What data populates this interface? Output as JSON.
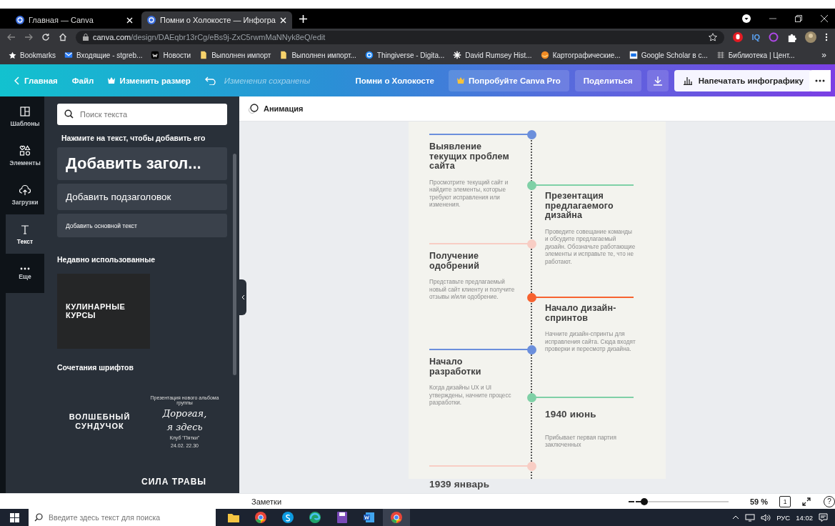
{
  "browser": {
    "tabs": [
      {
        "title": "Главная — Canva",
        "selected": false
      },
      {
        "title": "Помни о Холокосте — Инфогра",
        "selected": true
      }
    ],
    "url_host": "canva.com",
    "url_path": "/design/DAEqbr13rCg/eBs9j-ZxC5rwmMaNNyk8eQ/edit",
    "extension_label": "IQ",
    "bookmarks": [
      {
        "label": "Bookmarks",
        "kind": "star"
      },
      {
        "label": "Входящие - stgreb...",
        "kind": "mail"
      },
      {
        "label": "Новости",
        "kind": "vk"
      },
      {
        "label": "Выполнен импорт",
        "kind": "folder"
      },
      {
        "label": "Выполнен импорт...",
        "kind": "folder"
      },
      {
        "label": "Thingiverse - Digita...",
        "kind": "round"
      },
      {
        "label": "David Rumsey Hist...",
        "kind": "asterisk"
      },
      {
        "label": "Картографические...",
        "kind": "orange"
      },
      {
        "label": "Google Scholar в с...",
        "kind": "scholar"
      },
      {
        "label": "Библиотека | Цент...",
        "kind": "library"
      }
    ],
    "bookmarks_more": "»"
  },
  "toolbar": {
    "home": "Главная",
    "file": "Файл",
    "resize": "Изменить размер",
    "save_status": "Изменения сохранены",
    "design_title": "Помни о Холокосте",
    "pro": "Попробуйте Canva Pro",
    "share": "Поделиться",
    "print": "Напечатать инфографику"
  },
  "rail": [
    {
      "label": "Шаблоны",
      "kind": "templates",
      "selected": false
    },
    {
      "label": "Элементы",
      "kind": "elements",
      "selected": false
    },
    {
      "label": "Загрузки",
      "kind": "uploads",
      "selected": false
    },
    {
      "label": "Текст",
      "kind": "text",
      "selected": true
    },
    {
      "label": "Еще",
      "kind": "more",
      "selected": false
    }
  ],
  "panel": {
    "search_placeholder": "Поиск текста",
    "hint": "Нажмите на текст, чтобы добавить его",
    "presets": [
      {
        "kind": "heading",
        "label": "Добавить загол..."
      },
      {
        "kind": "subheading",
        "label": "Добавить подзаголовок"
      },
      {
        "kind": "body",
        "label": "Добавить основной текст"
      }
    ],
    "recent_title": "Недавно использованные",
    "recent_template": "КУЛИНАРНЫЕ КУРСЫ",
    "combos_title": "Сочетания шрифтов",
    "combos": [
      {
        "kind": "block",
        "lines": [
          "ВОЛШЕБНЫЙ СУНДУЧОК"
        ]
      },
      {
        "kind": "script",
        "lines": [
          "Презентация нового альбома группы",
          "Дорогая,",
          "я здесь",
          "Клуб \"Пятки\"",
          "24.02. 22.30"
        ]
      }
    ],
    "next_combo": "СИЛА ТРАВЫ"
  },
  "canvas": {
    "animation": "Анимация",
    "timeline": [
      {
        "kind": "step",
        "color": "#6b8fdc",
        "title": "Выявление текущих проблем сайта",
        "body": "Просмотрите текущий сайт и найдите элементы, которые требуют исправления или изменения."
      },
      {
        "kind": "step",
        "color": "#7fd0a6",
        "title": "Презентация предлагаемого дизайна",
        "body": "Проведите совещание команды и обсудите предлагаемый дизайн. Обозначьте работающие элементы и исправьте те, что не работают."
      },
      {
        "kind": "step",
        "color": "#f8cdc4",
        "title": "Получение одобрений",
        "body": "Представьте предлагаемый новый сайт клиенту и получите отзывы и/или одобрение."
      },
      {
        "kind": "step",
        "color": "#f7622f",
        "title": "Начало дизайн-спринтов",
        "body": "Начните дизайн-спринты для исправления сайта. Сюда входят проверки и пересмотр дизайна."
      },
      {
        "kind": "step",
        "color": "#6b8fdc",
        "title": "Начало разработки",
        "body": "Когда дизайны UX и UI утверждены, начните процесс разработки."
      },
      {
        "kind": "date",
        "color": "#7fd0a6",
        "title": "1940 июнь",
        "body": "Прибывает первая партия заключенных"
      },
      {
        "kind": "date",
        "color": "#f8cdc4",
        "title": "1939 январь"
      }
    ]
  },
  "bottom": {
    "notes": "Заметки",
    "zoom": {
      "level": 0.09
    },
    "zoom_reading": "59 %",
    "page": "1",
    "help": "?"
  },
  "taskbar": {
    "search_placeholder": "Введите здесь текст для поиска",
    "language": "РУС",
    "time": "14:02"
  }
}
